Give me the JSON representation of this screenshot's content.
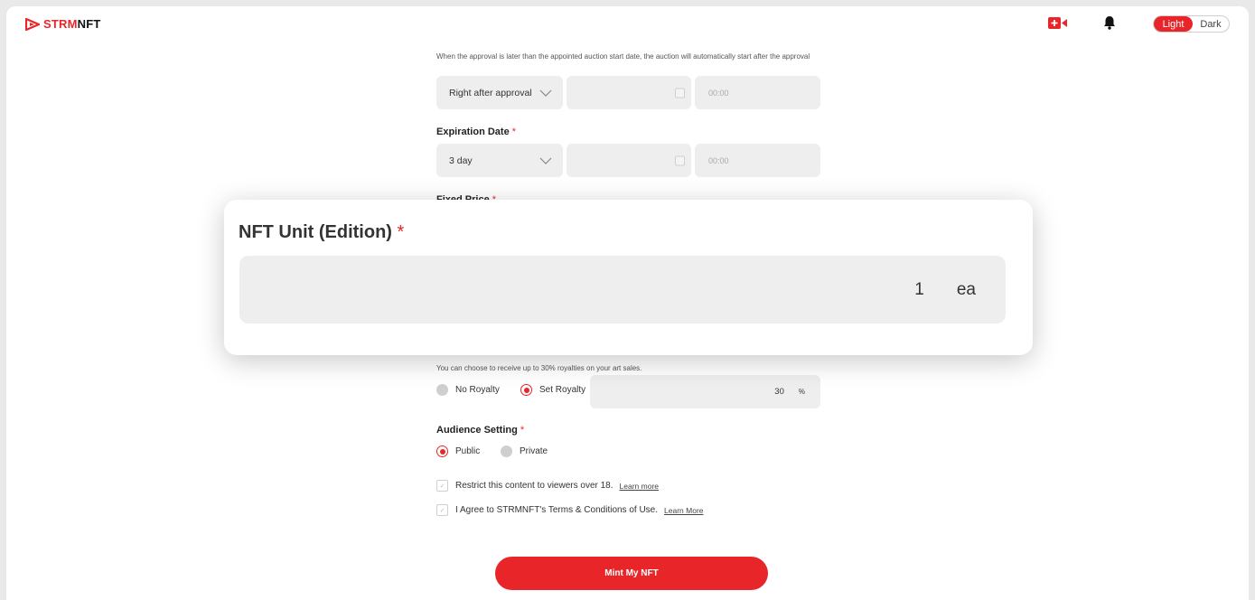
{
  "header": {
    "logo_text_a": "STRM",
    "logo_text_b": "NFT",
    "theme": {
      "light": "Light",
      "dark": "Dark",
      "selected": "Light"
    },
    "icons": [
      "logo-icon",
      "live-video-icon",
      "bell-icon"
    ]
  },
  "start": {
    "help": "When the approval is later than the appointed auction start date, the auction will automatically start after the approval",
    "select_value": "Right after approval",
    "time_placeholder": "00:00"
  },
  "expiration": {
    "label": "Expiration Date",
    "select_value": "3 day",
    "time_placeholder": "00:00"
  },
  "fixed_price": {
    "label": "Fixed Price"
  },
  "nft_unit": {
    "label": "NFT Unit (Edition)",
    "value": "1",
    "unit": "ea"
  },
  "royalty": {
    "help": "You can choose to receive up to 30% royalties on your art sales.",
    "options": [
      "No Royalty",
      "Set Royalty"
    ],
    "selected": "Set Royalty",
    "value": "30",
    "unit": "%"
  },
  "audience": {
    "label": "Audience Setting",
    "options": [
      "Public",
      "Private"
    ],
    "selected": "Public"
  },
  "agreements": [
    {
      "text": "Restrict this content to viewers over 18.",
      "link": "Learn more"
    },
    {
      "text": "I Agree to STRMNFT's Terms & Conditions of Use.",
      "link": "Learn More"
    }
  ],
  "required_mark": "*",
  "mint_button": "Mint My NFT",
  "colors": {
    "accent": "#e8262a",
    "field_bg": "#eeeeee"
  }
}
